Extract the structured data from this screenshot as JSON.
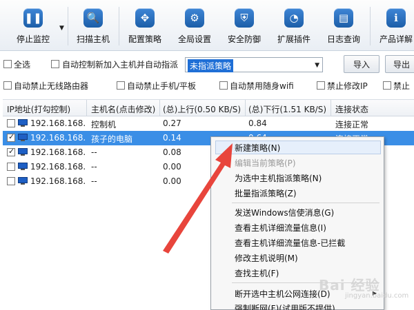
{
  "toolbar": {
    "items": [
      {
        "label": "停止监控",
        "icon": "pause-icon"
      },
      {
        "label": "扫描主机",
        "icon": "search-icon"
      },
      {
        "label": "配置策略",
        "icon": "move-icon"
      },
      {
        "label": "全局设置",
        "icon": "gear-icon"
      },
      {
        "label": "安全防御",
        "icon": "shield-icon"
      },
      {
        "label": "扩展插件",
        "icon": "pie-icon"
      },
      {
        "label": "日志查询",
        "icon": "log-icon"
      },
      {
        "label": "产品详解",
        "icon": "info-icon"
      }
    ]
  },
  "options": {
    "select_all": "全选",
    "auto_assign": "自动控制新加入主机并自动指派",
    "policy_select_value": "未指派策略",
    "import_button": "导入",
    "export_button": "导出",
    "ban_router": "自动禁止无线路由器",
    "ban_phone": "自动禁止手机/平板",
    "ban_wifi": "自动禁用随身wifi",
    "ban_ip": "禁止修改IP",
    "ban_truncated": "禁止"
  },
  "table": {
    "headers": [
      "IP地址(打勾控制)",
      "主机名(点击修改)",
      "(总)上行(0.50 KB/S)",
      "(总)下行(1.51 KB/S)",
      "连接状态"
    ],
    "rows": [
      {
        "ip": "192.168.168.5",
        "host": "控制机",
        "up": "0.27",
        "down": "0.84",
        "status": "连接正常",
        "checked": false
      },
      {
        "ip": "192.168.168.2",
        "host": "孩子的电脑",
        "up": "0.14",
        "down": "0.64",
        "status": "连接正常",
        "checked": true
      },
      {
        "ip": "192.168.168.4",
        "host": "--",
        "up": "0.08",
        "down": "",
        "status": "",
        "checked": true
      },
      {
        "ip": "192.168.168...",
        "host": "--",
        "up": "0.00",
        "down": "",
        "status": "",
        "checked": false
      },
      {
        "ip": "192.168.168...",
        "host": "--",
        "up": "0.00",
        "down": "",
        "status": "",
        "checked": false
      }
    ]
  },
  "menu": {
    "items": [
      "新建策略(N)",
      "编辑当前策略(P)",
      "为选中主机指派策略(N)",
      "批量指派策略(Z)",
      "发送Windows信使消息(G)",
      "查看主机详细流量信息(I)",
      "查看主机详细流量信息-已拦截",
      "修改主机说明(M)",
      "查找主机(F)",
      "断开选中主机公网连接(D)",
      "强制断网(F)(试用版不提供)"
    ]
  },
  "watermark": {
    "text": "Bai 经验",
    "sub": "jingyan.baidu.com"
  },
  "colors": {
    "selection": "#3a8ee6",
    "arrow": "#e8453c",
    "icon_blue": "#1c5ea8"
  }
}
